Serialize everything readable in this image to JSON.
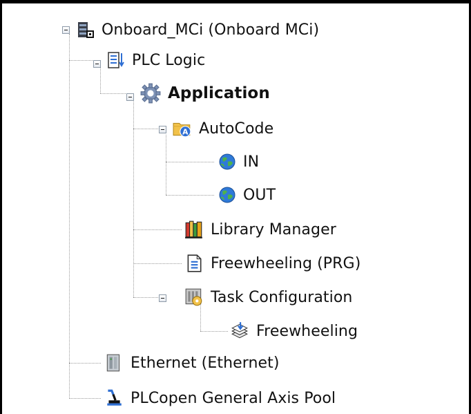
{
  "tree": {
    "device": {
      "label": "Onboard_MCi (Onboard MCi)",
      "icon": "plc-device-icon"
    },
    "plc_logic": {
      "label": "PLC Logic",
      "icon": "plc-logic-icon"
    },
    "application": {
      "label": "Application",
      "icon": "application-gear-icon"
    },
    "autocode": {
      "label": "AutoCode",
      "icon": "autocode-folder-icon"
    },
    "in": {
      "label": "IN",
      "icon": "globe-icon"
    },
    "out": {
      "label": "OUT",
      "icon": "globe-icon"
    },
    "library_manager": {
      "label": "Library Manager",
      "icon": "library-books-icon"
    },
    "freewheeling_prg": {
      "label": "Freewheeling (PRG)",
      "icon": "program-document-icon"
    },
    "task_configuration": {
      "label": "Task Configuration",
      "icon": "task-configuration-icon"
    },
    "freewheeling_task": {
      "label": "Freewheeling",
      "icon": "task-stack-icon"
    },
    "ethernet": {
      "label": "Ethernet (Ethernet)",
      "icon": "ethernet-device-icon"
    },
    "axis_pool": {
      "label": "PLCopen General Axis Pool",
      "icon": "axis-pool-icon"
    }
  },
  "colors": {
    "line": "#9a9a9a",
    "text": "#111111",
    "accent_blue": "#2f6fd3",
    "folder_yellow": "#f2c24a"
  }
}
